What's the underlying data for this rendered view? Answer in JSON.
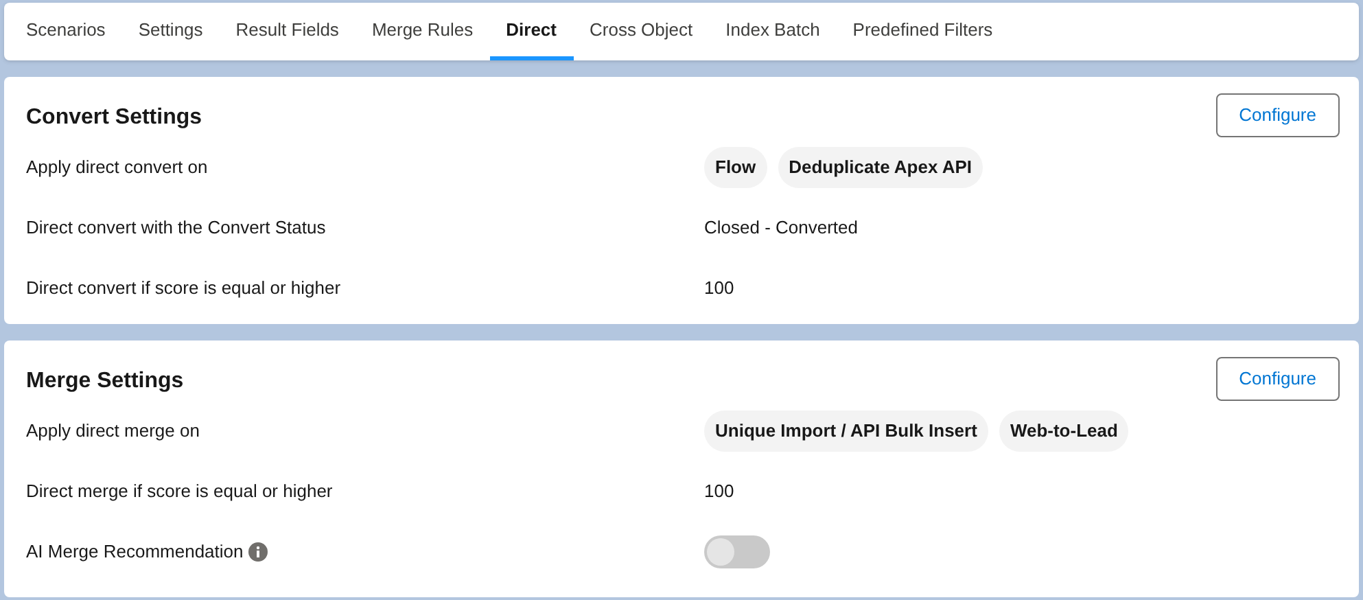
{
  "tabs": [
    {
      "label": "Scenarios",
      "selected": false
    },
    {
      "label": "Settings",
      "selected": false
    },
    {
      "label": "Result Fields",
      "selected": false
    },
    {
      "label": "Merge Rules",
      "selected": false
    },
    {
      "label": "Direct",
      "selected": true
    },
    {
      "label": "Cross Object",
      "selected": false
    },
    {
      "label": "Index Batch",
      "selected": false
    },
    {
      "label": "Predefined Filters",
      "selected": false
    }
  ],
  "sections": [
    {
      "title": "Convert Settings",
      "button": "Configure",
      "rows": [
        {
          "kind": "chips",
          "label": "Apply direct convert on",
          "chips": [
            "Flow",
            "Deduplicate Apex API"
          ]
        },
        {
          "kind": "text",
          "label": "Direct convert with the Convert Status",
          "value": "Closed - Converted"
        },
        {
          "kind": "text",
          "label": "Direct convert if score is equal or higher",
          "value": "100"
        }
      ]
    },
    {
      "title": "Merge Settings",
      "button": "Configure",
      "rows": [
        {
          "kind": "chips",
          "label": "Apply direct merge on",
          "chips": [
            "Unique Import / API Bulk Insert",
            "Web-to-Lead"
          ]
        },
        {
          "kind": "text",
          "label": "Direct merge if score is equal or higher",
          "value": "100"
        },
        {
          "kind": "toggle",
          "label": "AI Merge Recommendation",
          "info": true,
          "on": false
        }
      ]
    }
  ]
}
